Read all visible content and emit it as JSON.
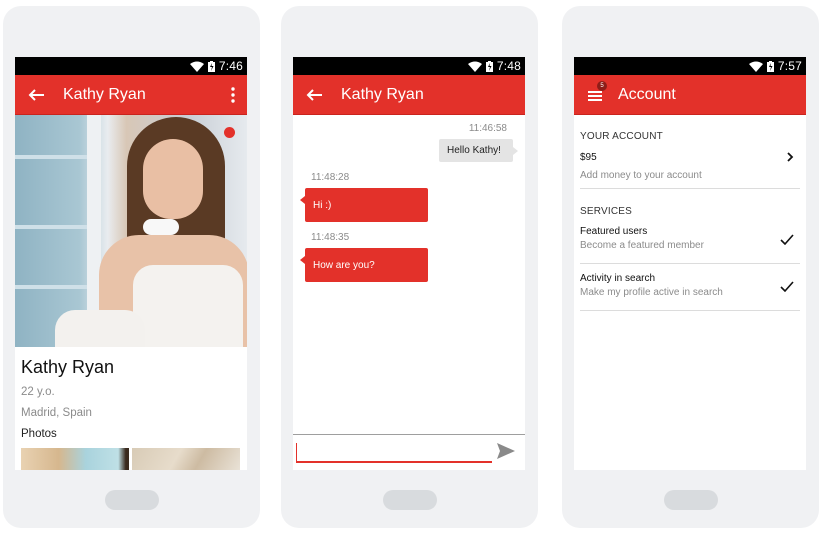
{
  "theme": {
    "accent": "#e3312a",
    "status_bar": "#000000",
    "frame": "#f0f1f3"
  },
  "profile_screen": {
    "status": {
      "time": "7:46",
      "wifi_icon": "wifi-icon",
      "battery_icon": "battery-charging-icon"
    },
    "appbar": {
      "title": "Kathy Ryan",
      "back_icon": "arrow-left-icon",
      "menu_icon": "more-vertical-icon"
    },
    "photo": {
      "alt": "Profile photo of Kathy Ryan",
      "online_indicator": "online-dot"
    },
    "name": "Kathy Ryan",
    "age": "22 y.o.",
    "location": "Madrid, Spain",
    "photos_heading": "Photos"
  },
  "chat_screen": {
    "status": {
      "time": "7:48"
    },
    "appbar": {
      "title": "Kathy Ryan"
    },
    "messages": [
      {
        "direction": "outgoing",
        "time": "11:46:58",
        "text": "Hello Kathy!"
      },
      {
        "direction": "incoming",
        "time": "11:48:28",
        "text": "Hi :)"
      },
      {
        "direction": "incoming",
        "time": "11:48:35",
        "text": "How are you?"
      }
    ],
    "composer": {
      "value": "",
      "placeholder": "",
      "send_icon": "send-icon"
    }
  },
  "account_screen": {
    "status": {
      "time": "7:57"
    },
    "appbar": {
      "title": "Account",
      "notification_count": "5",
      "menu_icon": "hamburger-menu-icon"
    },
    "your_account": {
      "heading": "YOUR ACCOUNT",
      "balance": "$95",
      "subtitle": "Add money to your account"
    },
    "services": {
      "heading": "SERVICES",
      "items": [
        {
          "title": "Featured users",
          "subtitle": "Become a featured member",
          "checked": true
        },
        {
          "title": "Activity in search",
          "subtitle": "Make my profile active in search",
          "checked": true
        }
      ]
    }
  }
}
